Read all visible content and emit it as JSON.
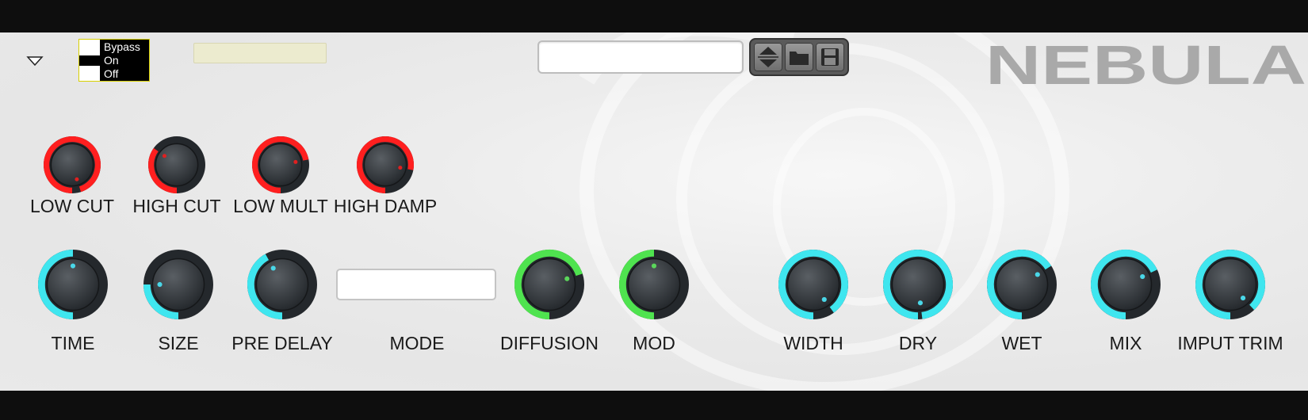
{
  "header": {
    "bypass_options": [
      "Bypass",
      "On",
      "Off"
    ],
    "preset_tag_text": "",
    "preset_name": "",
    "brand": "NEBULA"
  },
  "colors": {
    "ring_red": "#ff1f1f",
    "ring_cyan": "#3fe6ef",
    "ring_green": "#4fe34f",
    "knob_dark": "#2b2f33",
    "dot_red": "#e02020",
    "dot_cyan": "#4ad7e8",
    "dot_green": "#5bd65b"
  },
  "knobs_row1": [
    {
      "label": "LOW CUT",
      "value": 0.95,
      "color": "red"
    },
    {
      "label": "HIGH CUT",
      "value": 0.35,
      "color": "red"
    },
    {
      "label": "LOW MULT",
      "value": 0.72,
      "color": "red"
    },
    {
      "label": "HIGH DAMP",
      "value": 0.78,
      "color": "red"
    }
  ],
  "knobs_row2": [
    {
      "label": "TIME",
      "value": 0.5,
      "color": "cyan"
    },
    {
      "label": "SIZE",
      "value": 0.25,
      "color": "cyan"
    },
    {
      "label": "PRE DELAY",
      "value": 0.42,
      "color": "cyan"
    }
  ],
  "mode": {
    "label": "MODE",
    "value": ""
  },
  "knobs_row2b": [
    {
      "label": "DIFFUSION",
      "value": 0.7,
      "color": "green"
    },
    {
      "label": "MOD",
      "value": 0.5,
      "color": "green"
    }
  ],
  "knobs_row3": [
    {
      "label": "WIDTH",
      "value": 0.9,
      "color": "cyan"
    },
    {
      "label": "DRY",
      "value": 0.98,
      "color": "cyan"
    },
    {
      "label": "WET",
      "value": 0.66,
      "color": "cyan"
    },
    {
      "label": "MIX",
      "value": 0.68,
      "color": "cyan"
    },
    {
      "label": "IMPUT TRIM",
      "value": 0.88,
      "color": "cyan"
    }
  ]
}
